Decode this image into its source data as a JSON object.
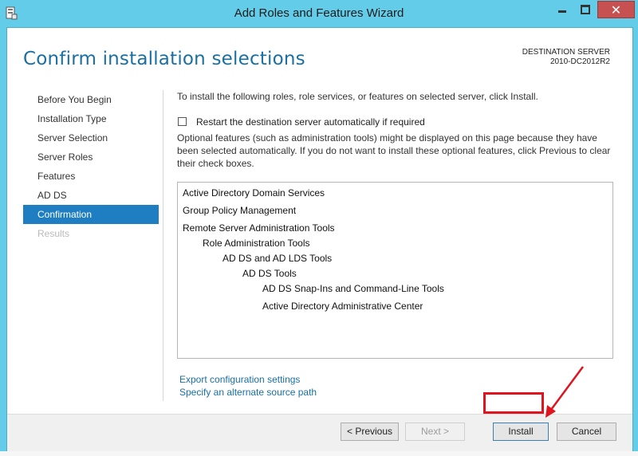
{
  "window": {
    "title": "Add Roles and Features Wizard",
    "close_symbol": "✕"
  },
  "header": {
    "page_title": "Confirm installation selections",
    "destination_label": "DESTINATION SERVER",
    "destination_value": "2010-DC2012R2"
  },
  "nav": {
    "items": [
      {
        "label": "Before You Begin"
      },
      {
        "label": "Installation Type"
      },
      {
        "label": "Server Selection"
      },
      {
        "label": "Server Roles"
      },
      {
        "label": "Features"
      },
      {
        "label": "AD DS"
      },
      {
        "label": "Confirmation"
      },
      {
        "label": "Results"
      }
    ],
    "active": "Confirmation",
    "disabled": "Results"
  },
  "content": {
    "intro": "To install the following roles, role services, or features on selected server, click Install.",
    "restart_label": "Restart the destination server automatically if required",
    "restart_checked": false,
    "optional_text": "Optional features (such as administration tools) might be displayed on this page because they have been selected automatically. If you do not want to install these optional features, click Previous to clear their check boxes.",
    "features": [
      {
        "label": "Active Directory Domain Services",
        "level": 0
      },
      {
        "label": "Group Policy Management",
        "level": 0
      },
      {
        "label": "Remote Server Administration Tools",
        "level": 0
      },
      {
        "label": "Role Administration Tools",
        "level": 1
      },
      {
        "label": "AD DS and AD LDS Tools",
        "level": 2
      },
      {
        "label": "AD DS Tools",
        "level": 3
      },
      {
        "label": "AD DS Snap-Ins and Command-Line Tools",
        "level": 4
      },
      {
        "label": "Active Directory Administrative Center",
        "level": 4
      }
    ],
    "export_link": "Export configuration settings",
    "alternate_link": "Specify an alternate source path"
  },
  "footer": {
    "previous_label": "< Previous",
    "next_label": "Next >",
    "install_label": "Install",
    "cancel_label": "Cancel"
  },
  "colors": {
    "title_bar": "#63cde9",
    "accent_blue": "#1f7ec2",
    "annotation_red": "#e0141e"
  },
  "icons": {
    "app": "server-manager-icon",
    "minimize": "minimize-icon",
    "maximize": "maximize-icon",
    "close": "close-icon"
  }
}
